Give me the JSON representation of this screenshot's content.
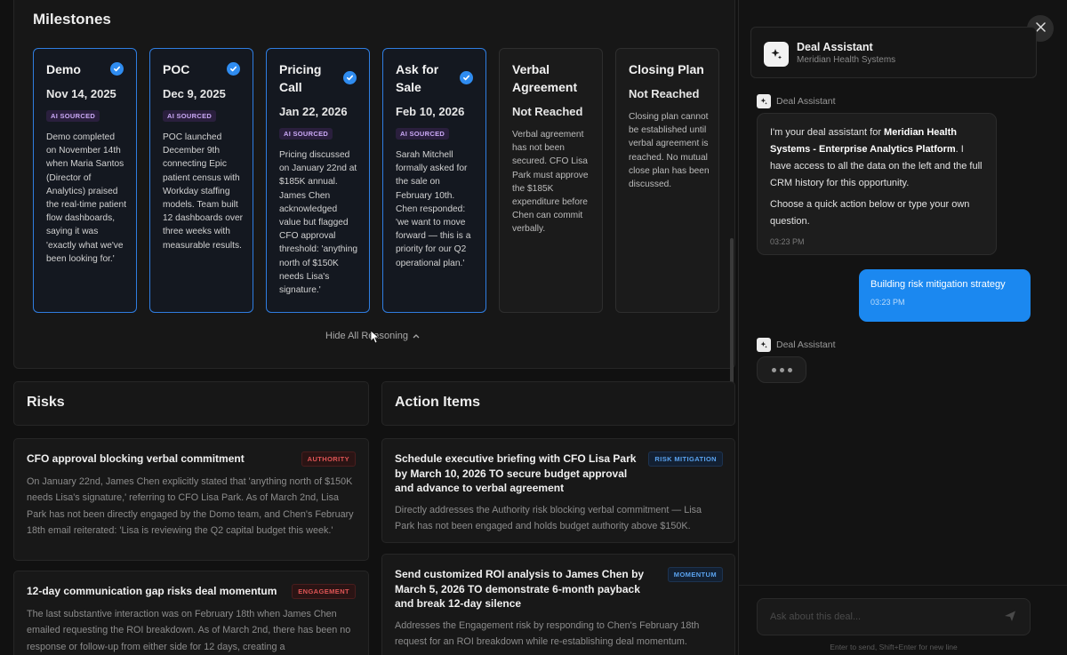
{
  "milestones": {
    "title": "Milestones",
    "ai_badge": "AI SOURCED",
    "hide_label": "Hide All Reasoning",
    "items": [
      {
        "name": "Demo",
        "date": "Nov 14, 2025",
        "status": "done",
        "body": "Demo completed on November 14th when Maria Santos (Director of Analytics) praised the real-time patient flow dashboards, saying it was 'exactly what we've been looking for.'"
      },
      {
        "name": "POC",
        "date": "Dec 9, 2025",
        "status": "done",
        "body": "POC launched December 9th connecting Epic patient census with Workday staffing models. Team built 12 dashboards over three weeks with measurable results."
      },
      {
        "name": "Pricing Call",
        "date": "Jan 22, 2026",
        "status": "done",
        "body": "Pricing discussed on January 22nd at $185K annual. James Chen acknowledged value but flagged CFO approval threshold: 'anything north of $150K needs Lisa's signature.'"
      },
      {
        "name": "Ask for Sale",
        "date": "Feb 10, 2026",
        "status": "done",
        "body": "Sarah Mitchell formally asked for the sale on February 10th. Chen responded: 'we want to move forward — this is a priority for our Q2 operational plan.'"
      },
      {
        "name": "Verbal Agreement",
        "date": "Not Reached",
        "status": "pending",
        "body": "Verbal agreement has not been secured. CFO Lisa Park must approve the $185K expenditure before Chen can commit verbally."
      },
      {
        "name": "Closing Plan",
        "date": "Not Reached",
        "status": "pending",
        "body": "Closing plan cannot be established until verbal agreement is reached. No mutual close plan has been discussed."
      }
    ]
  },
  "risks": {
    "title": "Risks",
    "items": [
      {
        "title": "CFO approval blocking verbal commitment",
        "tag": "AUTHORITY",
        "text": "On January 22nd, James Chen explicitly stated that 'anything north of $150K needs Lisa's signature,' referring to CFO Lisa Park. As of March 2nd, Lisa Park has not been directly engaged by the Domo team, and Chen's February 18th email reiterated: 'Lisa is reviewing the Q2 capital budget this week.'"
      },
      {
        "title": "12-day communication gap risks deal momentum",
        "tag": "ENGAGEMENT",
        "text": "The last substantive interaction was on February 18th when James Chen emailed requesting the ROI breakdown. As of March 2nd, there has been no response or follow-up from either side for 12 days, creating a"
      }
    ]
  },
  "actions": {
    "title": "Action Items",
    "items": [
      {
        "title": "Schedule executive briefing with CFO Lisa Park by March 10, 2026 TO secure budget approval and advance to verbal agreement",
        "tag": "RISK MITIGATION",
        "text": "Directly addresses the Authority risk blocking verbal commitment — Lisa Park has not been engaged and holds budget authority above $150K."
      },
      {
        "title": "Send customized ROI analysis to James Chen by March 5, 2026 TO demonstrate 6-month payback and break 12-day silence",
        "tag": "MOMENTUM",
        "text": "Addresses the Engagement risk by responding to Chen's February 18th request for an ROI breakdown while re-establishing deal momentum."
      }
    ]
  },
  "assistant": {
    "name": "Deal Assistant",
    "subtitle": "Meridian Health Systems",
    "sender": "Deal Assistant",
    "msg_intro": "I'm your deal assistant for ",
    "msg_bold": "Meridian Health Systems - Enterprise Analytics Platform",
    "msg_rest": ". I have access to all the data on the left and the full CRM history for this opportunity.",
    "msg_2": "Choose a quick action below or type your own question.",
    "msg_time": "03:23 PM",
    "user_msg": "Building risk mitigation strategy",
    "user_time": "03:23 PM",
    "input_placeholder": "Ask about this deal...",
    "hint": "Enter to send, Shift+Enter for new line"
  },
  "colors": {
    "accent": "#1b88f0",
    "check": "#2f8cf0",
    "risk_tag": "#e05555",
    "action_tag": "#5aa3f0",
    "ai_badge": "#c9a8f5"
  }
}
